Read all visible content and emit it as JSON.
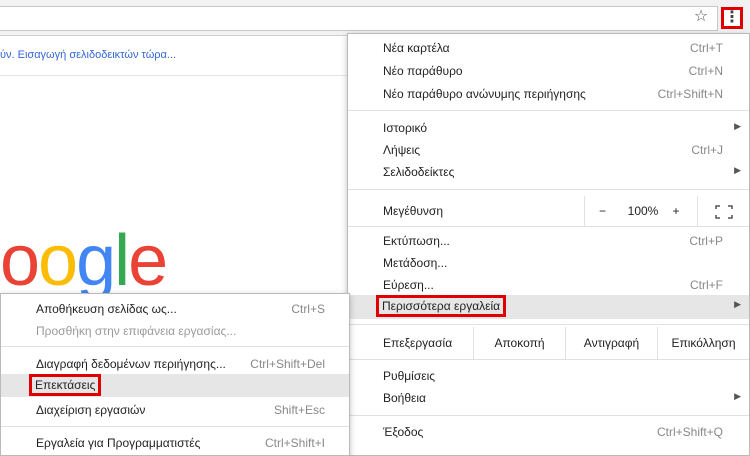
{
  "toolbar": {
    "star_icon": "star-icon",
    "menu_icon": "kebab-menu-icon"
  },
  "bookmarks": {
    "prompt": "ύν. Εισαγωγή σελιδοδεικτών τώρα..."
  },
  "logo": {
    "text": "oogle"
  },
  "menu": {
    "new_tab": {
      "label": "Νέα καρτέλα",
      "shortcut": "Ctrl+T"
    },
    "new_window": {
      "label": "Νέο παράθυρο",
      "shortcut": "Ctrl+N"
    },
    "incognito": {
      "label": "Νέο παράθυρο ανώνυμης περιήγησης",
      "shortcut": "Ctrl+Shift+N"
    },
    "history": {
      "label": "Ιστορικό"
    },
    "downloads": {
      "label": "Λήψεις",
      "shortcut": "Ctrl+J"
    },
    "bookmarks": {
      "label": "Σελιδοδείκτες"
    },
    "zoom": {
      "label": "Μεγέθυνση",
      "minus": "−",
      "value": "100%",
      "plus": "+"
    },
    "print": {
      "label": "Εκτύπωση...",
      "shortcut": "Ctrl+P"
    },
    "cast": {
      "label": "Μετάδοση..."
    },
    "find": {
      "label": "Εύρεση...",
      "shortcut": "Ctrl+F"
    },
    "more_tools": {
      "label": "Περισσότερα εργαλεία"
    },
    "edit": {
      "label": "Επεξεργασία",
      "cut": "Αποκοπή",
      "copy": "Αντιγραφή",
      "paste": "Επικόλληση"
    },
    "settings": {
      "label": "Ρυθμίσεις"
    },
    "help": {
      "label": "Βοήθεια"
    },
    "exit": {
      "label": "Έξοδος",
      "shortcut": "Ctrl+Shift+Q"
    }
  },
  "submenu": {
    "save_page": {
      "label": "Αποθήκευση σελίδας ως...",
      "shortcut": "Ctrl+S"
    },
    "add_desktop": {
      "label": "Προσθήκη στην επιφάνεια εργασίας..."
    },
    "clear_data": {
      "label": "Διαγραφή δεδομένων περιήγησης...",
      "shortcut": "Ctrl+Shift+Del"
    },
    "extensions": {
      "label": "Επεκτάσεις"
    },
    "task_manager": {
      "label": "Διαχείριση εργασιών",
      "shortcut": "Shift+Esc"
    },
    "dev_tools": {
      "label": "Εργαλεία για Προγραμματιστές",
      "shortcut": "Ctrl+Shift+I"
    }
  },
  "accent": {
    "highlight_border": "#e00000",
    "link": "#3367d6"
  }
}
